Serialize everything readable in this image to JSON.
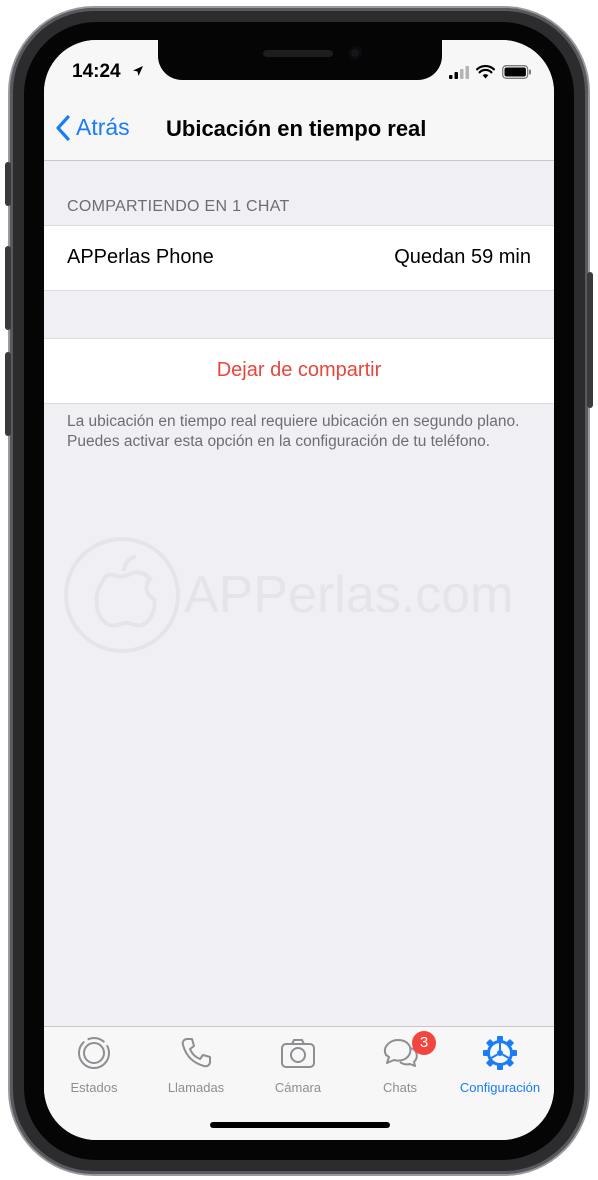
{
  "status_bar": {
    "time": "14:24"
  },
  "nav": {
    "back_label": "Atrás",
    "title": "Ubicación en tiempo real"
  },
  "sharing_section": {
    "header": "COMPARTIENDO EN 1 CHAT",
    "row": {
      "name": "APPerlas Phone",
      "value": "Quedan 59 min"
    }
  },
  "stop_button": {
    "label": "Dejar de compartir"
  },
  "footer_note": "La ubicación en tiempo real requiere ubicación en segundo plano. Puedes activar esta opción en la configuración de tu teléfono.",
  "watermark": {
    "text": "APPerlas.com"
  },
  "tabbar": {
    "tabs": [
      {
        "label": "Estados",
        "icon": "status-icon"
      },
      {
        "label": "Llamadas",
        "icon": "phone-icon"
      },
      {
        "label": "Cámara",
        "icon": "camera-icon"
      },
      {
        "label": "Chats",
        "icon": "chats-icon",
        "badge": "3"
      },
      {
        "label": "Configuración",
        "icon": "gear-icon",
        "active": true
      }
    ]
  },
  "colors": {
    "accent": "#1a7cf7",
    "destructive": "#e8453c",
    "badge": "#f2453d",
    "background": "#efeff4"
  }
}
